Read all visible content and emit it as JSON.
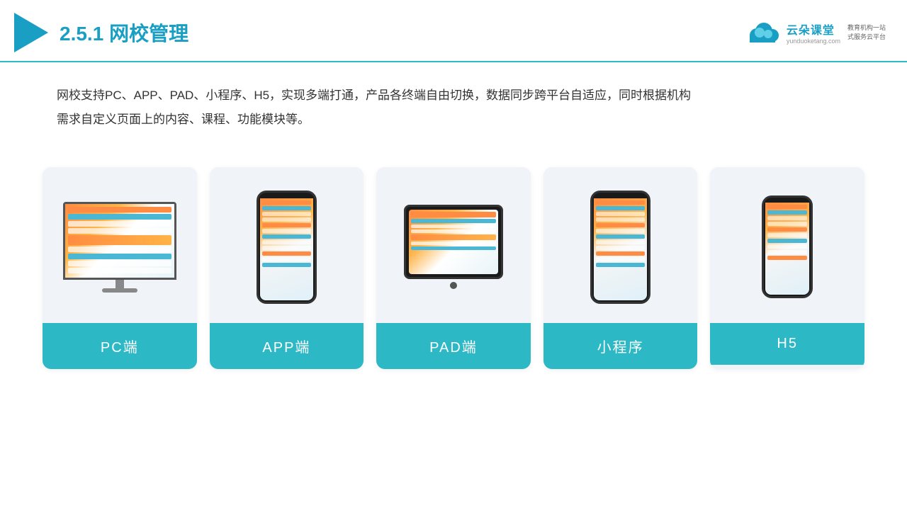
{
  "header": {
    "section": "2.5.1",
    "title": "网校管理",
    "divider_color": "#2db8c5"
  },
  "brand": {
    "name": "云朵课堂",
    "url": "yunduoketang.com",
    "slogan1": "教育机构一站",
    "slogan2": "式服务云平台"
  },
  "description": "网校支持PC、APP、PAD、小程序、H5，实现多端打通，产品各终端自由切换，数据同步跨平台自适应，同时根据机构",
  "description2": "需求自定义页面上的内容、课程、功能模块等。",
  "cards": [
    {
      "id": "pc",
      "label": "PC端"
    },
    {
      "id": "app",
      "label": "APP端"
    },
    {
      "id": "pad",
      "label": "PAD端"
    },
    {
      "id": "miniapp",
      "label": "小程序"
    },
    {
      "id": "h5",
      "label": "H5"
    }
  ]
}
